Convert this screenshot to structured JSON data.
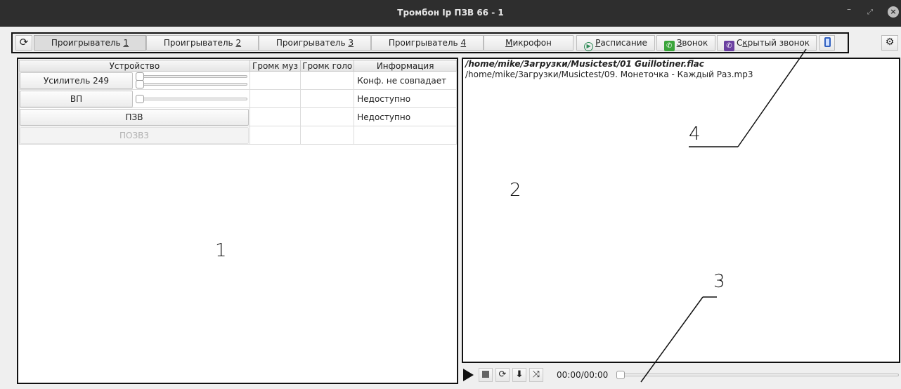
{
  "window": {
    "title": "Тромбон Ip ПЗВ 66 - 1"
  },
  "toolbar": {
    "tabs": [
      {
        "label_pre": "Проигрыватель ",
        "label_key": "1"
      },
      {
        "label_pre": "Проигрыватель ",
        "label_key": "2"
      },
      {
        "label_pre": "Проигрыватель ",
        "label_key": "3"
      },
      {
        "label_pre": "Проигрыватель ",
        "label_key": "4"
      }
    ],
    "mic": {
      "key": "М",
      "rest": "икрофон"
    },
    "schedule": {
      "key": "Р",
      "rest": "асписание"
    },
    "call": {
      "key": "З",
      "rest": "вонок"
    },
    "hidden_call": {
      "pre": "С",
      "key": "к",
      "rest": "рытый звонок"
    },
    "icons": {
      "refresh": "refresh-icon",
      "settings": "gears-icon",
      "phone": "mobile-phone-icon"
    }
  },
  "devices": {
    "headers": [
      "Устройство",
      "Громк муз",
      "Громк голо",
      "Информация"
    ],
    "rows": [
      {
        "name": "Усилитель 249",
        "info": "Конф. не совпадает",
        "music_volume": 0,
        "voice_volume": 0
      },
      {
        "name": "ВП",
        "info": "Недоступно",
        "music_volume": 0
      },
      {
        "name": "ПЗВ",
        "info": "Недоступно"
      },
      {
        "name": "ПОЗВ3",
        "info": ""
      }
    ]
  },
  "playlist": {
    "items": [
      "/home/mike/Загрузки/Musictest/01 Guillotiner.flac",
      "/home/mike/Загрузки/Musictest/09.  Монеточка  -  Каждый Раз.mp3"
    ],
    "current_index": 0
  },
  "player": {
    "time": "00:00/00:00",
    "position": 0,
    "icons": [
      "play-icon",
      "stop-icon",
      "repeat-icon",
      "download-icon",
      "shuffle-icon"
    ]
  },
  "annotations": [
    "1",
    "2",
    "3",
    "4"
  ],
  "colors": {
    "titlebar": "#2e2e2e",
    "schedule_icon": "#2e8b57",
    "call_icon": "#3aa43a",
    "hidden_call_icon": "#6a3fa0",
    "phone_icon": "#3060c0"
  }
}
